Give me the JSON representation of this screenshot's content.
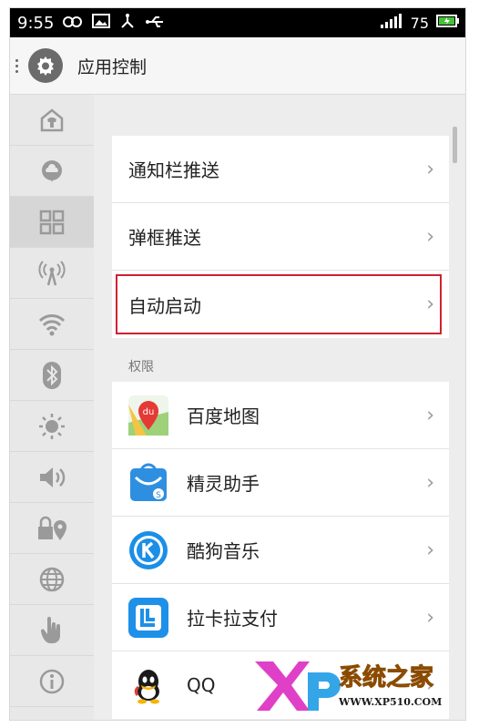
{
  "status": {
    "time": "9:55",
    "battery": "75",
    "icons": [
      "infinity-icon",
      "image-icon",
      "usb-tree-icon",
      "usb-icon",
      "signal-icon",
      "battery-icon"
    ]
  },
  "appbar": {
    "title": "应用控制"
  },
  "sidebar": {
    "items": [
      "home-shirt-icon",
      "cloud-icon",
      "grid-icon",
      "antenna-icon",
      "wifi-icon",
      "bluetooth-icon",
      "brightness-icon",
      "volume-icon",
      "lock-location-icon",
      "globe-icon",
      "hand-icon",
      "info-icon"
    ],
    "active_index": 2
  },
  "push": {
    "rows": [
      {
        "label": "通知栏推送"
      },
      {
        "label": "弹框推送"
      },
      {
        "label": "自动启动"
      }
    ]
  },
  "permissions": {
    "section_label": "权限",
    "apps": [
      {
        "label": "百度地图",
        "icon": "baidu-maps-icon",
        "color": "#e8f3e6"
      },
      {
        "label": "精灵助手",
        "icon": "jingling-icon",
        "color": "#2e8fe0"
      },
      {
        "label": "酷狗音乐",
        "icon": "kugou-icon",
        "color": "#1b8fe6"
      },
      {
        "label": "拉卡拉支付",
        "icon": "lakala-icon",
        "color": "#1e90e8"
      },
      {
        "label": "QQ",
        "icon": "qq-icon",
        "color": "#ffffff"
      }
    ]
  },
  "watermark": {
    "brand": "系统之家",
    "url": "WWW.XP510.COM"
  }
}
